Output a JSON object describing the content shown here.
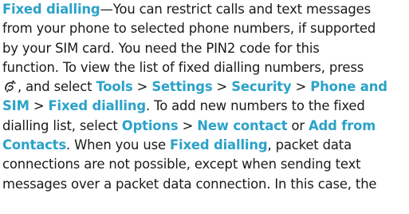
{
  "paragraph": {
    "lines": [
      [
        {
          "t": "Fixed dialling",
          "hl": true
        },
        {
          "t": "—You can restrict calls and text messages",
          "hl": false
        }
      ],
      [
        {
          "t": "from your phone to selected phone numbers, if supported",
          "hl": false
        }
      ],
      [
        {
          "t": "by your SIM card. You need the PIN2 code for this",
          "hl": false
        }
      ],
      [
        {
          "t": "function. To view the list of fixed dialling numbers, press",
          "hl": false
        }
      ],
      [
        {
          "icon": "menu-key-icon"
        },
        {
          "t": ", and select ",
          "hl": false
        },
        {
          "t": "Tools",
          "hl": true
        },
        {
          "t": " > ",
          "hl": false
        },
        {
          "t": "Settings",
          "hl": true
        },
        {
          "t": " > ",
          "hl": false
        },
        {
          "t": "Security",
          "hl": true
        },
        {
          "t": " > ",
          "hl": false
        },
        {
          "t": "Phone and",
          "hl": true
        }
      ],
      [
        {
          "t": "SIM",
          "hl": true
        },
        {
          "t": " > ",
          "hl": false
        },
        {
          "t": "Fixed dialling",
          "hl": true
        },
        {
          "t": ". To add new numbers to the fixed",
          "hl": false
        }
      ],
      [
        {
          "t": "dialling list, select ",
          "hl": false
        },
        {
          "t": "Options",
          "hl": true
        },
        {
          "t": " > ",
          "hl": false
        },
        {
          "t": "New contact",
          "hl": true
        },
        {
          "t": " or ",
          "hl": false
        },
        {
          "t": "Add from",
          "hl": true
        }
      ],
      [
        {
          "t": "Contacts",
          "hl": true
        },
        {
          "t": ". When you use ",
          "hl": false
        },
        {
          "t": "Fixed dialling",
          "hl": true
        },
        {
          "t": ", packet data",
          "hl": false
        }
      ],
      [
        {
          "t": "connections are not possible, except when sending text",
          "hl": false
        }
      ],
      [
        {
          "t": "messages over a packet data connection. In this case, the",
          "hl": false
        }
      ]
    ]
  },
  "colors": {
    "text": "#1a1a1a",
    "highlight": "#2ba2c8"
  }
}
